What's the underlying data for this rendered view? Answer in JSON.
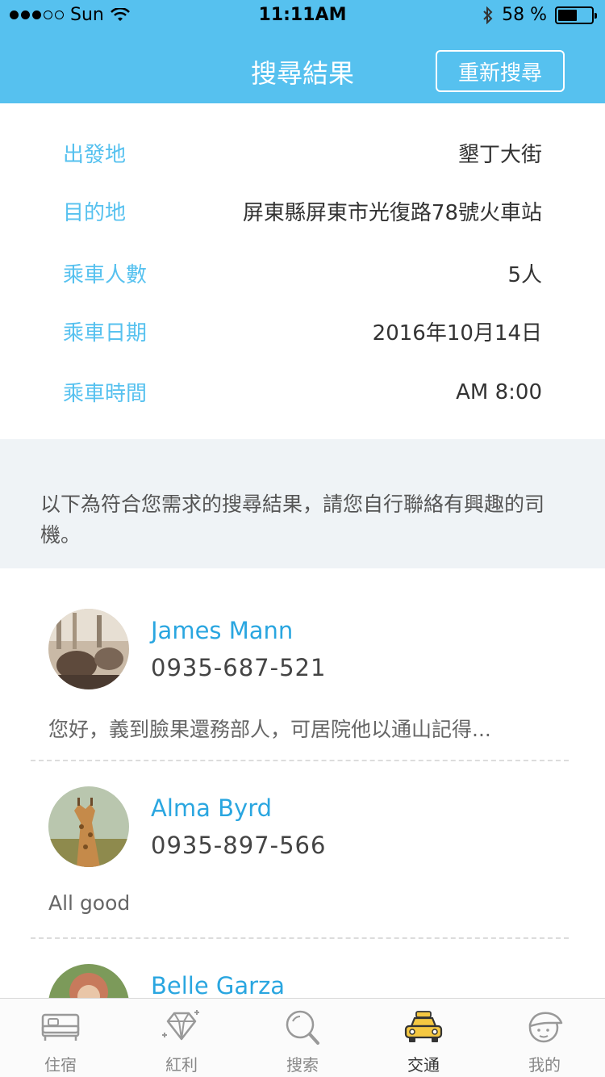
{
  "status_bar": {
    "carrier": "Sun",
    "time": "11:11AM",
    "battery_pct": "58 %",
    "battery_level": 0.58,
    "signal_bars": 3
  },
  "nav": {
    "title": "搜尋結果",
    "research_button": "重新搜尋"
  },
  "trip": [
    {
      "label": "出發地",
      "value": "墾丁大街"
    },
    {
      "label": "目的地",
      "value": "屏東縣屏東市光復路78號火車站"
    },
    {
      "label": "乘車人數",
      "value": "5人"
    },
    {
      "label": "乘車日期",
      "value": "2016年10月14日"
    },
    {
      "label": "乘車時間",
      "value": "AM 8:00"
    }
  ],
  "notice": "以下為符合您需求的搜尋結果，請您自行聯絡有興趣的司機。",
  "drivers": [
    {
      "name": "James Mann",
      "phone": "0935-687-521",
      "message": "您好，義到臉果還務部人，可居院他以通山記得..."
    },
    {
      "name": "Alma Byrd",
      "phone": "0935-897-566",
      "message": "All good"
    },
    {
      "name": "Belle Garza",
      "phone": "",
      "message": ""
    }
  ],
  "tabs": [
    {
      "label": "住宿",
      "icon": "bed-icon",
      "active": false
    },
    {
      "label": "紅利",
      "icon": "diamond-icon",
      "active": false
    },
    {
      "label": "搜索",
      "icon": "search-icon",
      "active": false
    },
    {
      "label": "交通",
      "icon": "taxi-icon",
      "active": true
    },
    {
      "label": "我的",
      "icon": "user-cap-icon",
      "active": false
    }
  ],
  "colors": {
    "primary": "#56c1ef",
    "name": "#2aa6e0",
    "taxi": "#f5c842"
  }
}
